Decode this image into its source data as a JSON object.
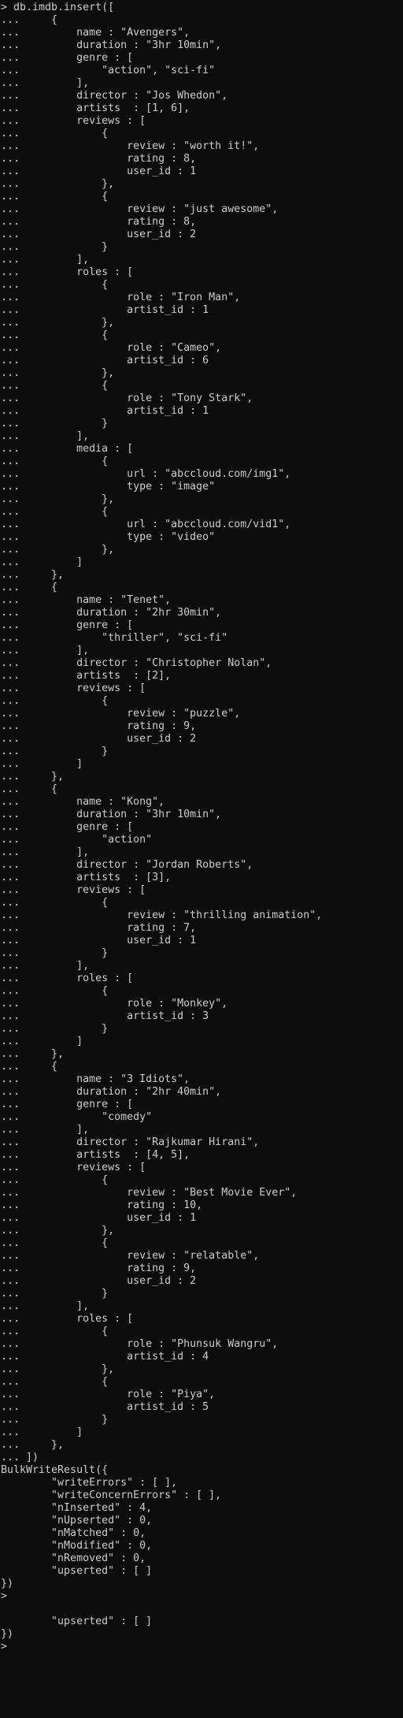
{
  "terminal": {
    "lines": [
      "> db.imdb.insert([",
      "...     {",
      "...         name : \"Avengers\",",
      "...         duration : \"3hr 10min\",",
      "...         genre : [",
      "...             \"action\", \"sci-fi\"",
      "...         ],",
      "...         director : \"Jos Whedon\",",
      "...         artists  : [1, 6],",
      "...         reviews : [",
      "...             {",
      "...                 review : \"worth it!\",",
      "...                 rating : 8,",
      "...                 user_id : 1",
      "...             },",
      "...             {",
      "...                 review : \"just awesome\",",
      "...                 rating : 8,",
      "...                 user_id : 2",
      "...             }",
      "...         ],",
      "...         roles : [",
      "...             {",
      "...                 role : \"Iron Man\",",
      "...                 artist_id : 1",
      "...             },",
      "...             {",
      "...                 role : \"Cameo\",",
      "...                 artist_id : 6",
      "...             },",
      "...             {",
      "...                 role : \"Tony Stark\",",
      "...                 artist_id : 1",
      "...             }",
      "...         ],",
      "...         media : [",
      "...             {",
      "...                 url : \"abccloud.com/img1\",",
      "...                 type : \"image\"",
      "...             },",
      "...             {",
      "...                 url : \"abccloud.com/vid1\",",
      "...                 type : \"video\"",
      "...             },",
      "...         ]",
      "...     },",
      "...     {",
      "...         name : \"Tenet\",",
      "...         duration : \"2hr 30min\",",
      "...         genre : [",
      "...             \"thriller\", \"sci-fi\"",
      "...         ],",
      "...         director : \"Christopher Nolan\",",
      "...         artists  : [2],",
      "...         reviews : [",
      "...             {",
      "...                 review : \"puzzle\",",
      "...                 rating : 9,",
      "...                 user_id : 2",
      "...             }",
      "...         ]",
      "...     },",
      "...     {",
      "...         name : \"Kong\",",
      "...         duration : \"3hr 10min\",",
      "...         genre : [",
      "...             \"action\"",
      "...         ],",
      "...         director : \"Jordan Roberts\",",
      "...         artists  : [3],",
      "...         reviews : [",
      "...             {",
      "...                 review : \"thrilling animation\",",
      "...                 rating : 7,",
      "...                 user_id : 1",
      "...             }",
      "...         ],",
      "...         roles : [",
      "...             {",
      "...                 role : \"Monkey\",",
      "...                 artist_id : 3",
      "...             }",
      "...         ]",
      "...     },",
      "...     {",
      "...         name : \"3 Idiots\",",
      "...         duration : \"2hr 40min\",",
      "...         genre : [",
      "...             \"comedy\"",
      "...         ],",
      "...         director : \"Rajkumar Hirani\",",
      "...         artists  : [4, 5],",
      "...         reviews : [",
      "...             {",
      "...                 review : \"Best Movie Ever\",",
      "...                 rating : 10,",
      "...                 user_id : 1",
      "...             },",
      "...             {",
      "...                 review : \"relatable\",",
      "...                 rating : 9,",
      "...                 user_id : 2",
      "...             }",
      "...         ],",
      "...         roles : [",
      "...             {",
      "...                 role : \"Phunsuk Wangru\",",
      "...                 artist_id : 4",
      "...             },",
      "...             {",
      "...                 role : \"Piya\",",
      "...                 artist_id : 5",
      "...             }",
      "...         ]",
      "...     },",
      "... ])",
      "BulkWriteResult({",
      "        \"writeErrors\" : [ ],",
      "        \"writeConcernErrors\" : [ ],",
      "        \"nInserted\" : 4,",
      "        \"nUpserted\" : 0,",
      "        \"nMatched\" : 0,",
      "        \"nModified\" : 0,",
      "        \"nRemoved\" : 0,",
      "        \"upserted\" : [ ]",
      "})",
      ">",
      "",
      "        \"upserted\" : [ ]",
      "})",
      ">"
    ]
  }
}
